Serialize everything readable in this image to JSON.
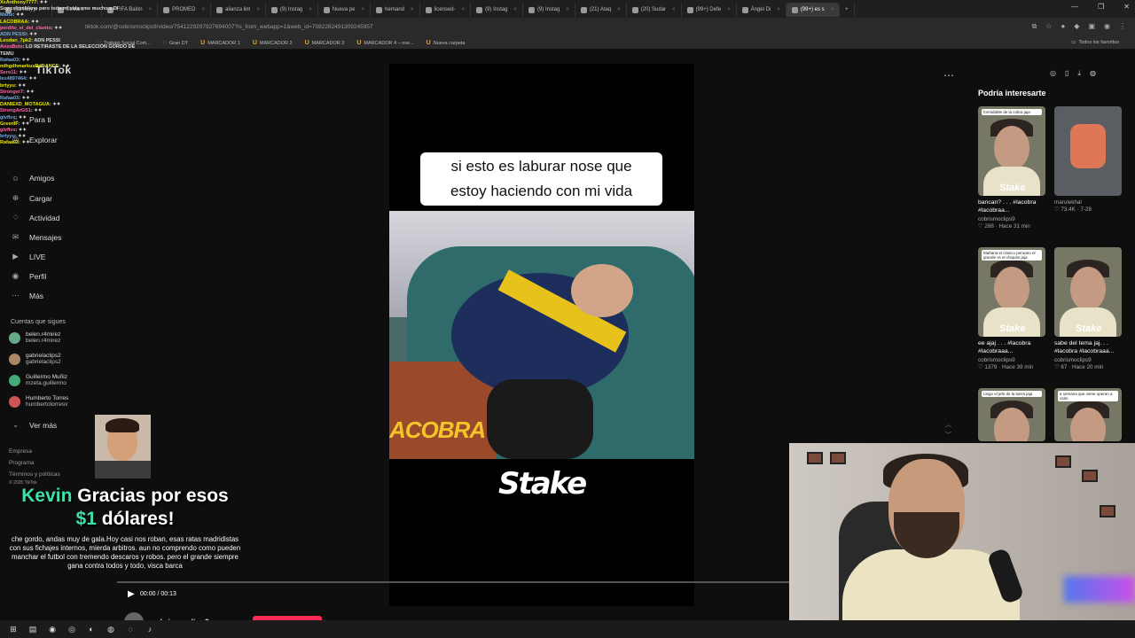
{
  "browser": {
    "tabs": [
      {
        "label": "(11466) p",
        "active": false
      },
      {
        "label": "Stream -",
        "active": false
      },
      {
        "label": "FIFA Balón",
        "active": false
      },
      {
        "label": "PROMED",
        "active": false
      },
      {
        "label": "alianza lim",
        "active": false
      },
      {
        "label": "(9) Instag",
        "active": false
      },
      {
        "label": "Nueva pe",
        "active": false
      },
      {
        "label": "hernand",
        "active": false
      },
      {
        "label": "licensed-",
        "active": false
      },
      {
        "label": "(9) Instag",
        "active": false
      },
      {
        "label": "(9) Instag",
        "active": false
      },
      {
        "label": "(21) Ataq",
        "active": false
      },
      {
        "label": "(20) Sudar",
        "active": false
      },
      {
        "label": "(99+) Defe",
        "active": false
      },
      {
        "label": "Ángel Di",
        "active": false
      },
      {
        "label": "(99+) es s",
        "active": true
      }
    ],
    "new_tab": "+",
    "url": "tiktok.com/@cobrismoclips9/video/7541229297927694007?is_from_webapp=1&web_id=7082262491309245957",
    "bookmarks": [
      "Trabajo Social Com...",
      "Gran DT",
      "MARCADOR 1",
      "MARCADOR 2",
      "MARCADOR 3",
      "MARCADOR 4 – ove...",
      "Nueva carpeta"
    ],
    "all_favorites": "Todos los favoritos"
  },
  "sidebar": {
    "brand": "TikTok",
    "nav": [
      {
        "label": "Para ti",
        "icon": "home-icon"
      },
      {
        "label": "Explorar",
        "icon": "compass-icon"
      },
      {
        "label": "Amigos",
        "icon": "friends-icon"
      },
      {
        "label": "Cargar",
        "icon": "upload-icon"
      },
      {
        "label": "Actividad",
        "icon": "bell-icon"
      },
      {
        "label": "Mensajes",
        "icon": "message-icon"
      },
      {
        "label": "LIVE",
        "icon": "live-icon"
      },
      {
        "label": "Perfil",
        "icon": "profile-icon"
      },
      {
        "label": "Más",
        "icon": "more-icon"
      }
    ],
    "following_title": "Cuentas que sigues",
    "following": [
      {
        "name": "belen.r4mirez",
        "handle": "belen.r4mirez"
      },
      {
        "name": "gabrielaclips2",
        "handle": "gabrielaclips2"
      },
      {
        "name": "Guillermo Muñiz",
        "handle": "mzeta.guillermo"
      },
      {
        "name": "Humberto Torres",
        "handle": "humbertotorresv"
      }
    ],
    "see_more": "Ver más",
    "footer": [
      "Empresa",
      "Programa",
      "Términos y políticas",
      "© 2025 TikTok"
    ]
  },
  "chat": [
    {
      "user": "XxAnthony7777",
      "msg": ""
    },
    {
      "user": "",
      "msg": "Soy colombiano pero toda mi vida eme mucho a Di"
    },
    {
      "user": "Marte",
      "msg": ""
    },
    {
      "user": "LACOBRAA",
      "msg": ""
    },
    {
      "user": "perdito_el_del_clavito",
      "msg": ""
    },
    {
      "user": "ADN PESSI",
      "msg": ""
    },
    {
      "user": "Leodan_7pk2",
      "msg": "ADN PESSI"
    },
    {
      "user": "AnzoBots",
      "msg": "LO RETIRASTE DE LA SELECCIÓN GORDO DE TEMU"
    },
    {
      "user": "Rafaa03",
      "msg": ""
    },
    {
      "user": "mIhgdhmarkusRdDANCE",
      "msg": ""
    },
    {
      "user": "Sero11",
      "msg": ""
    },
    {
      "user": "lex4897464",
      "msg": ""
    },
    {
      "user": "brtyyu",
      "msg": ""
    },
    {
      "user": "Stronger7",
      "msg": ""
    },
    {
      "user": "Rafaa03",
      "msg": ""
    },
    {
      "user": "DANIEXD_MOTAGUA",
      "msg": ""
    },
    {
      "user": "StrongArGS1",
      "msg": ""
    },
    {
      "user": "glvflvx",
      "msg": ""
    },
    {
      "user": "GreenIF",
      "msg": ""
    },
    {
      "user": "glvflvx",
      "msg": ""
    },
    {
      "user": "brtyyu",
      "msg": ""
    },
    {
      "user": "Rafaa03",
      "msg": ""
    }
  ],
  "donation": {
    "name": "Kevin",
    "line1_rest": "Gracias por esos",
    "amount": "$1",
    "line2_rest": "dólares!",
    "message": "che gordo, andas muy de gala.Hoy casi nos roban, esas ratas madridistas con sus fichajes internos, mierda arbitros. aun no comprendo como pueden manchar el futbol con tremendo descaros y robos. pero el grande siempre gana contra todos y todo, visca barca"
  },
  "video": {
    "caption_line1": "si esto es laburar nose que",
    "caption_line2": "estoy haciendo con mi vida",
    "jersey_text": "betsson",
    "watermark": "ACOBRA",
    "sponsor": "Stake",
    "time": "00:00 / 00:13",
    "author": "cobrismoclips9",
    "progress": 0.0
  },
  "recommended": {
    "title": "Podría interesarte",
    "cards": [
      {
        "overlay": "formidable de la cobra jaja",
        "title": "bancan? . . . #lacobra #lacobraa...",
        "user": "cobrismoclips9",
        "stats": "288 · Hace 31 min"
      },
      {
        "overlay": "",
        "title": "",
        "user": "marulekhal",
        "stats": "73.4K · 7-28"
      },
      {
        "overlay": "Mañana el clasico peruano el grande vs el chiquito jaja",
        "title": "ee ajaj . . . #lacobra #lacobraaa...",
        "user": "cobrismoclips9",
        "stats": "1379 · Hace 39 min"
      },
      {
        "overlay": "",
        "title": "sabe del tema jaj. . . #lacobra #lacobraaa...",
        "user": "cobrismoclips9",
        "stats": "67 · Hace 20 min"
      },
      {
        "overlay": "Llego el jefe de la barra jaja",
        "title": "",
        "user": "",
        "stats": ""
      },
      {
        "overlay": "a semana que viene operan a osito",
        "title": "",
        "user": "",
        "stats": ""
      }
    ]
  },
  "taskbar": [
    "windows-icon",
    "files-icon",
    "chrome-icon",
    "obs-icon",
    "edge-icon",
    "app-icon",
    "app2-icon",
    "tiktok-icon"
  ]
}
